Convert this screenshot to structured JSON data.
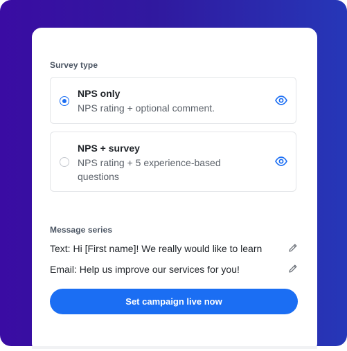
{
  "survey_type": {
    "label": "Survey type",
    "options": [
      {
        "title": "NPS only",
        "description": "NPS rating + optional comment.",
        "selected": true,
        "preview_icon": "eye-icon"
      },
      {
        "title": "NPS + survey",
        "description": "NPS rating + 5 experience-based questions",
        "selected": false,
        "preview_icon": "eye-icon"
      }
    ]
  },
  "message_series": {
    "label": "Message series",
    "items": [
      {
        "text": "Text: Hi [First name]! We really would like to learn",
        "edit_icon": "pencil-icon"
      },
      {
        "text": "Email: Help us improve our services for you!",
        "edit_icon": "pencil-icon"
      }
    ]
  },
  "cta": {
    "label": "Set campaign live now"
  },
  "colors": {
    "accent": "#1b6ef3",
    "background_gradient_start": "#3a0ca3",
    "background_gradient_end": "#2637b8"
  }
}
